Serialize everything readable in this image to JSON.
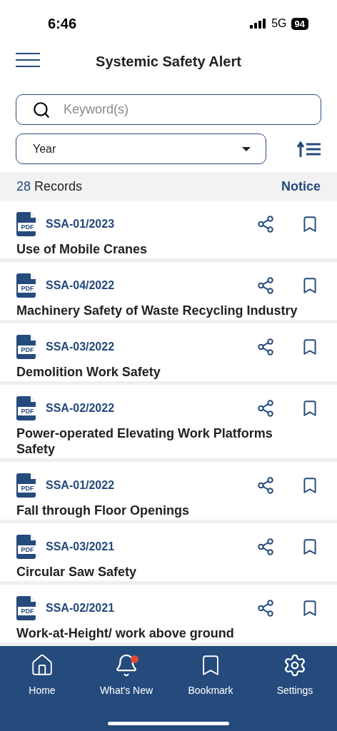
{
  "status_bar": {
    "time": "6:46",
    "network": "5G",
    "battery": "94"
  },
  "header": {
    "title": "Systemic Safety Alert"
  },
  "search": {
    "placeholder": "Keyword(s)"
  },
  "year_filter": {
    "value": "Year"
  },
  "summary": {
    "count": "28",
    "count_label": "Records",
    "notice": "Notice"
  },
  "records": [
    {
      "file_label": "PDF",
      "code": "SSA-01/2023",
      "title": "Use of Mobile Cranes"
    },
    {
      "file_label": "PDF",
      "code": "SSA-04/2022",
      "title": "Machinery Safety of Waste Recycling Industry"
    },
    {
      "file_label": "PDF",
      "code": "SSA-03/2022",
      "title": "Demolition Work Safety"
    },
    {
      "file_label": "PDF",
      "code": "SSA-02/2022",
      "title": "Power-operated Elevating Work Platforms Safety"
    },
    {
      "file_label": "PDF",
      "code": "SSA-01/2022",
      "title": "Fall through Floor Openings"
    },
    {
      "file_label": "PDF",
      "code": "SSA-03/2021",
      "title": "Circular Saw Safety"
    },
    {
      "file_label": "PDF",
      "code": "SSA-02/2021",
      "title": "Work-at-Height/ work above ground"
    }
  ],
  "tab_bar": [
    {
      "kind": "home",
      "label": "Home",
      "badge": false
    },
    {
      "kind": "bell",
      "label": "What's New",
      "badge": true
    },
    {
      "kind": "bookmark",
      "label": "Bookmark",
      "badge": false
    },
    {
      "kind": "settings",
      "label": "Settings",
      "badge": false
    }
  ]
}
